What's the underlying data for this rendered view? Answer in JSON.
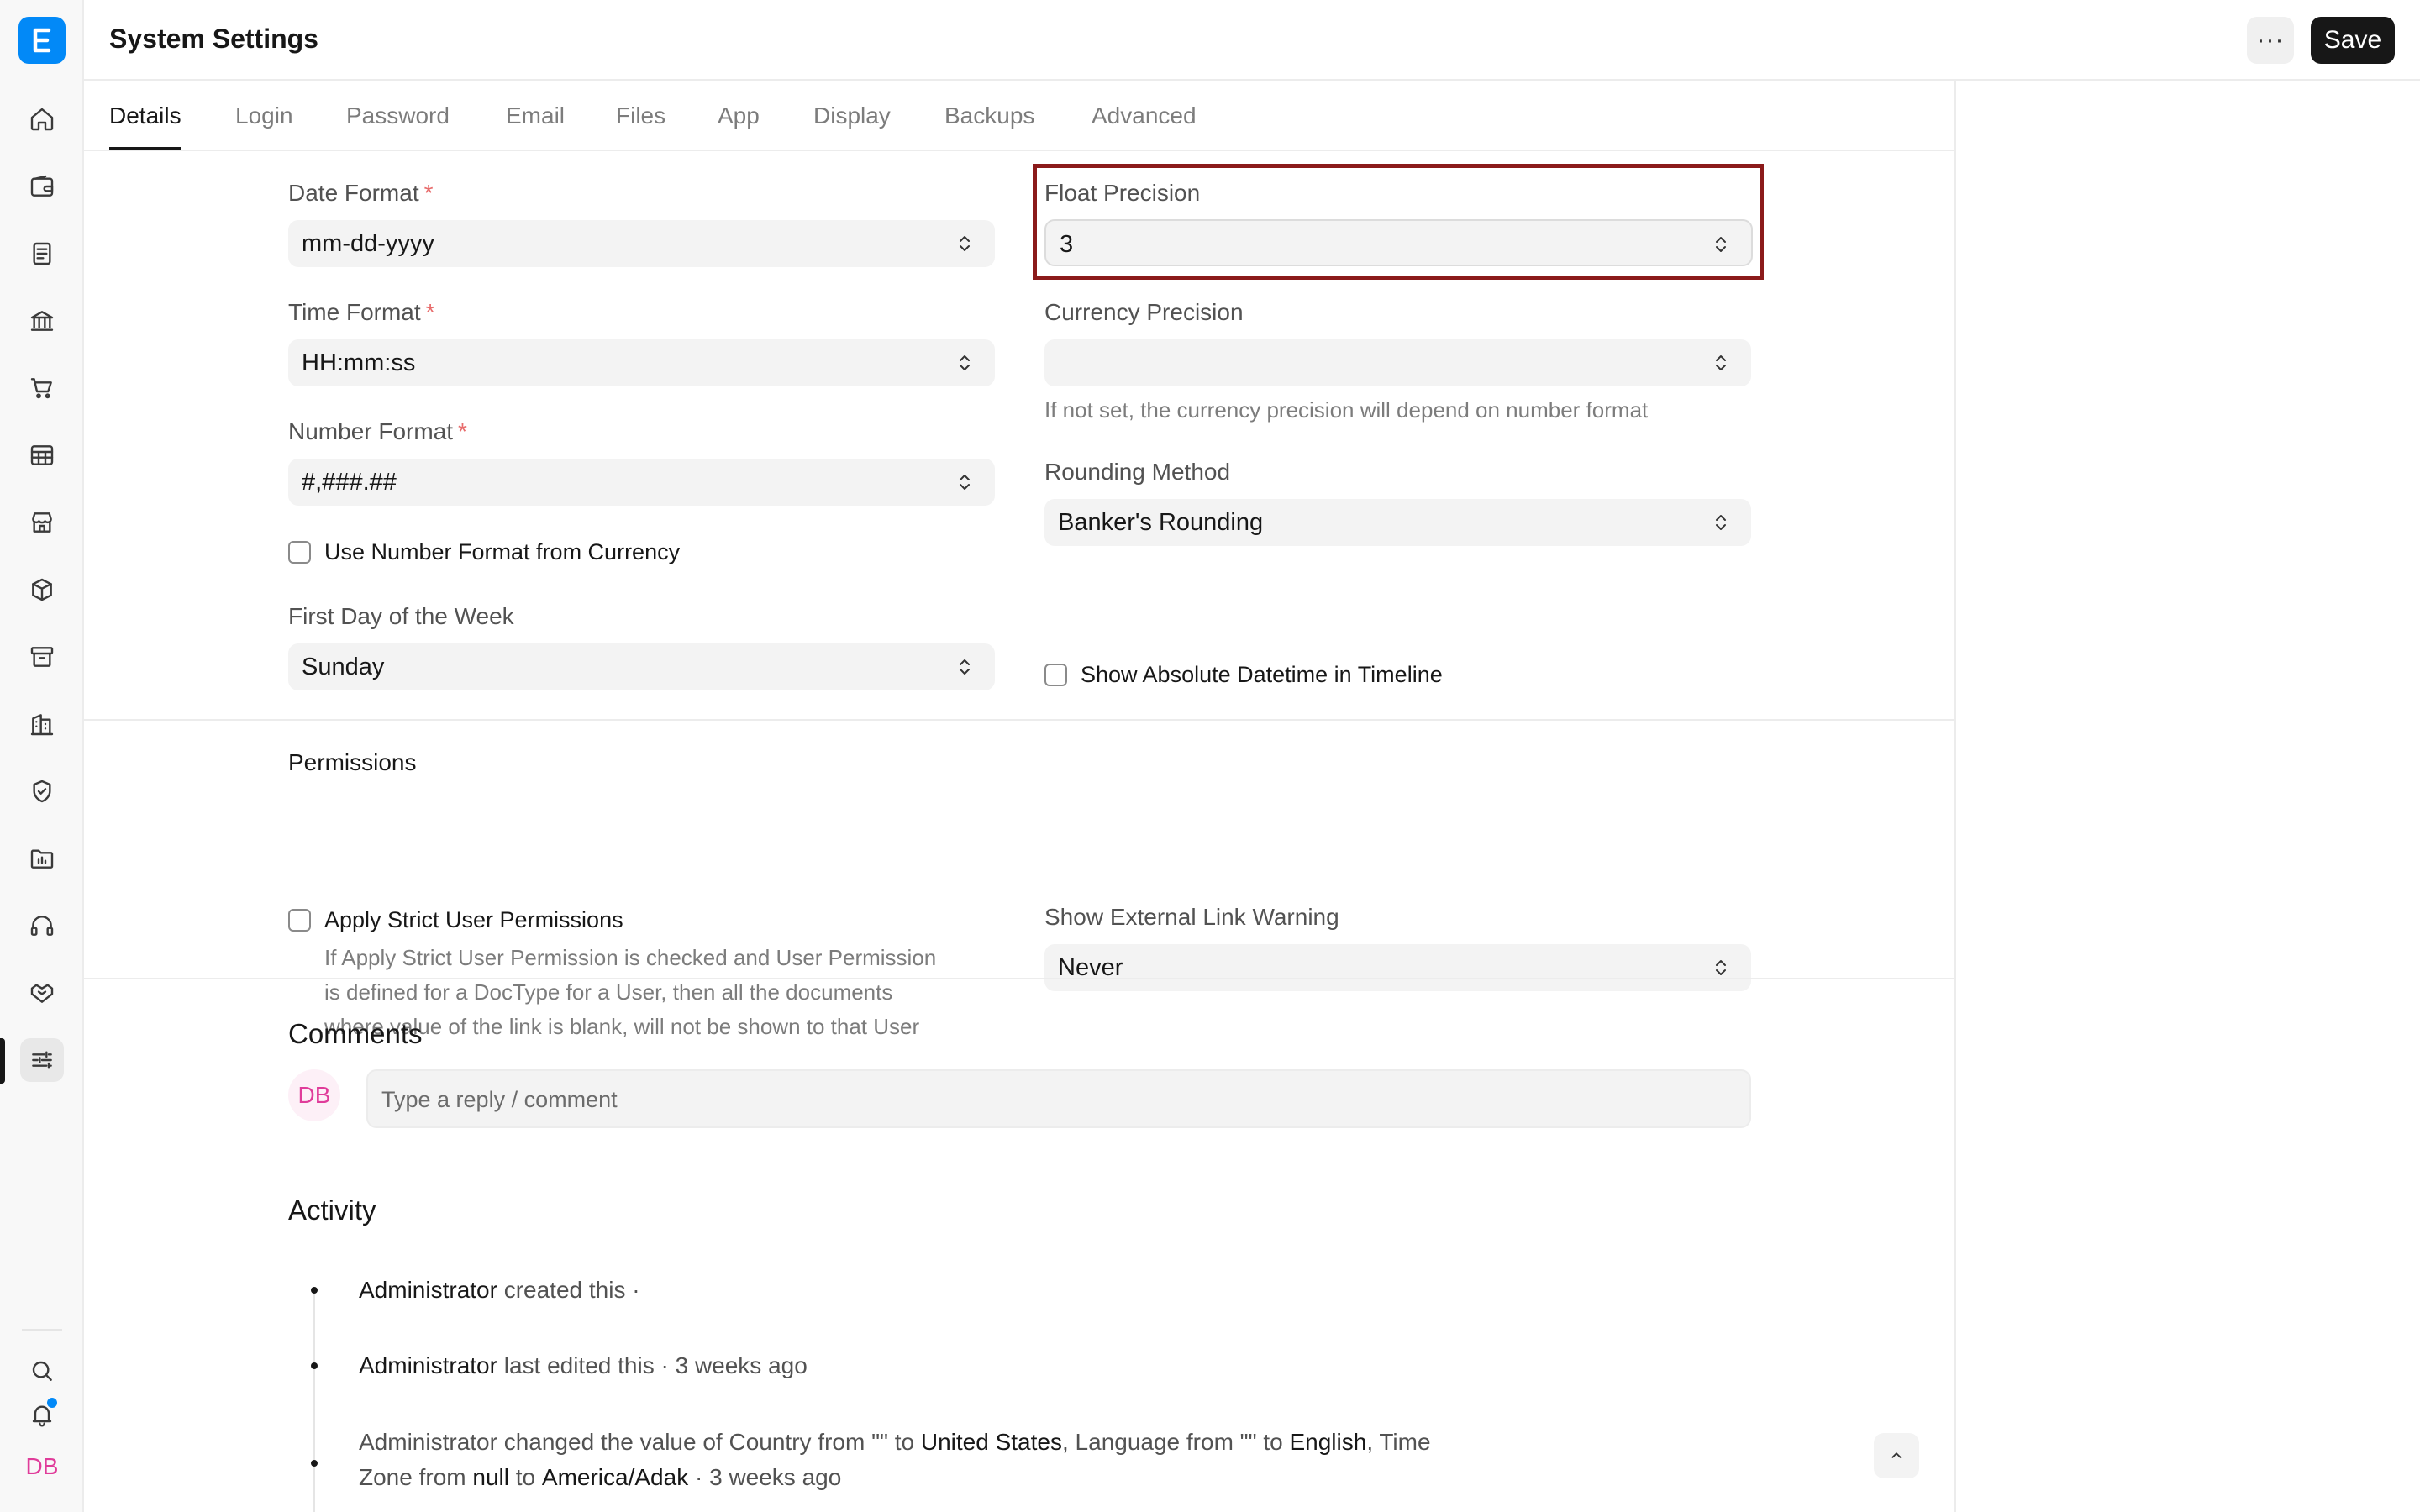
{
  "app": {
    "logo_letter": "E",
    "user_initials": "DB"
  },
  "header": {
    "title": "System Settings",
    "more_label": "···",
    "save_label": "Save"
  },
  "tabs": [
    {
      "label": "Details",
      "active": true
    },
    {
      "label": "Login"
    },
    {
      "label": "Password"
    },
    {
      "label": "Email"
    },
    {
      "label": "Files"
    },
    {
      "label": "App"
    },
    {
      "label": "Display"
    },
    {
      "label": "Backups"
    },
    {
      "label": "Advanced"
    }
  ],
  "sidebar": {
    "items": [
      {
        "icon": "home-icon"
      },
      {
        "icon": "wallet-icon"
      },
      {
        "icon": "document-icon"
      },
      {
        "icon": "bank-icon"
      },
      {
        "icon": "cart-icon"
      },
      {
        "icon": "table-icon"
      },
      {
        "icon": "store-icon"
      },
      {
        "icon": "box-icon"
      },
      {
        "icon": "archive-icon"
      },
      {
        "icon": "building-icon"
      },
      {
        "icon": "shield-icon"
      },
      {
        "icon": "folder-chart-icon"
      },
      {
        "icon": "headset-icon"
      },
      {
        "icon": "handshake-icon"
      },
      {
        "icon": "sliders-icon",
        "active": true
      }
    ],
    "bottom": [
      {
        "icon": "search-icon"
      },
      {
        "icon": "bell-icon"
      }
    ]
  },
  "details": {
    "date_format": {
      "label": "Date Format",
      "required": "*",
      "value": "mm-dd-yyyy"
    },
    "time_format": {
      "label": "Time Format",
      "required": "*",
      "value": "HH:mm:ss"
    },
    "number_format": {
      "label": "Number Format",
      "required": "*",
      "value": "#,###.##"
    },
    "use_number_format_from_currency": {
      "label": "Use Number Format from Currency",
      "checked": false
    },
    "first_day_of_week": {
      "label": "First Day of the Week",
      "value": "Sunday"
    },
    "float_precision": {
      "label": "Float Precision",
      "value": "3"
    },
    "currency_precision": {
      "label": "Currency Precision",
      "value": "",
      "help": "If not set, the currency precision will depend on number format"
    },
    "rounding_method": {
      "label": "Rounding Method",
      "value": "Banker's Rounding"
    },
    "show_absolute_datetime": {
      "label": "Show Absolute Datetime in Timeline",
      "checked": false
    }
  },
  "permissions": {
    "title": "Permissions",
    "apply_strict": {
      "label": "Apply Strict User Permissions",
      "checked": false,
      "help": [
        "If Apply Strict User Permission is checked and User Permission",
        "is defined for a DocType for a User, then all the documents",
        "where value of the link is blank, will not be shown to that User"
      ]
    },
    "external_link_warning": {
      "label": "Show External Link Warning",
      "value": "Never"
    }
  },
  "comments": {
    "title": "Comments",
    "avatar": "DB",
    "placeholder": "Type a reply / comment"
  },
  "activity": {
    "title": "Activity",
    "items": [
      {
        "actor": "Administrator",
        "text": " created this ·"
      },
      {
        "actor": "Administrator",
        "text": " last edited this · 3 weeks ago"
      },
      {
        "line1_pre": "Administrator changed the value of Country from \"\" to ",
        "country": "United States",
        "line1_mid": ", Language from \"\" to ",
        "language": "English",
        "line1_end": ", Time",
        "line2_pre": "Zone from ",
        "from_tz": "null",
        "line2_mid": " to ",
        "to_tz": "America/Adak",
        "line2_end": " · 3 weeks ago"
      }
    ]
  },
  "colors": {
    "accent": "#0289f7",
    "highlight": "#8b1a1a",
    "required": "#e86c6c",
    "avatar": "#e03c9a"
  }
}
